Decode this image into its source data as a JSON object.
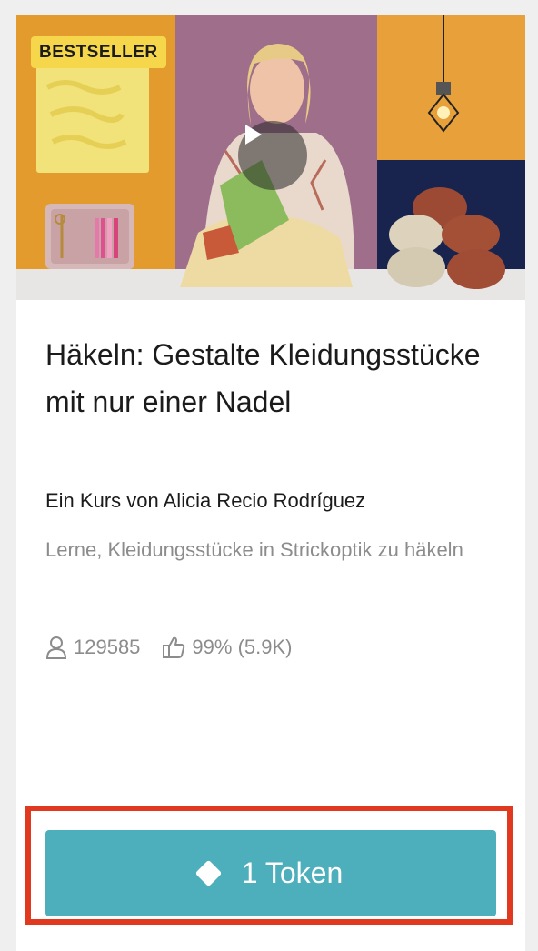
{
  "course": {
    "badge": "BESTSELLER",
    "title": "Häkeln: Gestalte Kleidungsstücke mit nur einer Nadel",
    "author": "Ein Kurs von Alicia Recio Rodríguez",
    "description": "Lerne, Kleidungsstücke in Strickoptik zu häkeln",
    "students": "129585",
    "rating": "99% (5.9K)"
  },
  "action": {
    "token_label": "1 Token"
  },
  "colors": {
    "badge_bg": "#f6d64a",
    "button_bg": "#4eafbc",
    "highlight_border": "#e0391f",
    "muted_text": "#8c8c8c"
  },
  "icons": {
    "play": "play-icon",
    "students": "user-icon",
    "rating": "thumbs-up-icon",
    "token": "diamond-icon"
  }
}
